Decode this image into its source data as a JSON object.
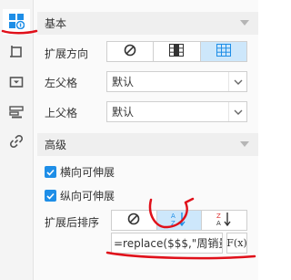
{
  "sidebar": {
    "items": [
      {
        "icon": "cell-attributes-icon",
        "active": true
      },
      {
        "icon": "style-icon"
      },
      {
        "icon": "widget-icon"
      },
      {
        "icon": "condition-icon"
      },
      {
        "icon": "hyperlink-icon"
      }
    ]
  },
  "basic": {
    "header": "基本",
    "expand_direction_label": "扩展方向",
    "left_parent_label": "左父格",
    "left_parent_value": "默认",
    "top_parent_label": "上父格",
    "top_parent_value": "默认"
  },
  "advanced": {
    "header": "高级",
    "horizontal_expand_label": "横向可伸展",
    "vertical_expand_label": "纵向可伸展",
    "sort_after_expand_label": "扩展后排序",
    "sort_formula": "=replace($$$,\"周销量",
    "fx_label": "F(x)"
  },
  "colors": {
    "accent": "#1e8ee7",
    "selected_option_bg": "#cde7fb",
    "annotation_red": "#e0101a"
  }
}
